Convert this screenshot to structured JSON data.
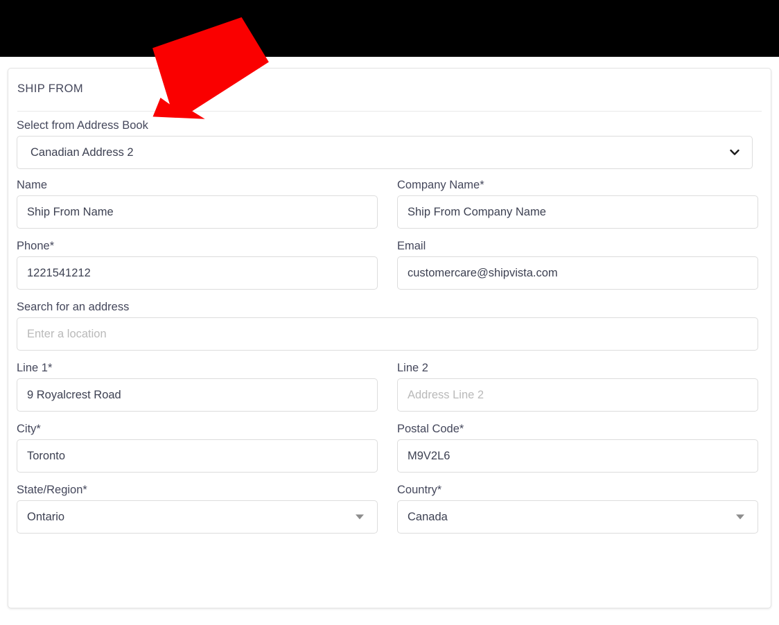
{
  "section": {
    "title": "SHIP FROM"
  },
  "address_book": {
    "label": "Select from Address Book",
    "selected": "Canadian Address 2",
    "icon": "chevron-down-icon"
  },
  "fields": {
    "name": {
      "label": "Name",
      "value": "Ship From Name"
    },
    "company_name": {
      "label": "Company Name*",
      "value": "Ship From Company Name"
    },
    "phone": {
      "label": "Phone*",
      "value": "1221541212"
    },
    "email": {
      "label": "Email",
      "value": "customercare@shipvista.com"
    },
    "search_address": {
      "label": "Search for an address",
      "value": "",
      "placeholder": "Enter a location"
    },
    "line1": {
      "label": "Line 1*",
      "value": "9 Royalcrest Road"
    },
    "line2": {
      "label": "Line 2",
      "value": "",
      "placeholder": "Address Line 2"
    },
    "city": {
      "label": "City*",
      "value": "Toronto"
    },
    "postal_code": {
      "label": "Postal Code*",
      "value": "M9V2L6"
    },
    "state_region": {
      "label": "State/Region*",
      "value": "Ontario",
      "icon": "caret-down-icon"
    },
    "country": {
      "label": "Country*",
      "value": "Canada",
      "icon": "caret-down-icon"
    }
  },
  "annotation": {
    "arrow": {
      "name": "red-pointer-arrow",
      "color": "#FA0000",
      "points_to": "Select from Address Book"
    }
  },
  "colors": {
    "top_bar": "#000000",
    "card_background": "#FFFFFF",
    "card_border": "#E4E4E4",
    "label_text": "#44475B",
    "input_text": "#3D4152",
    "placeholder_text": "#B9B9B9",
    "input_border": "#DCDCDC",
    "arrow_red": "#FA0000"
  }
}
